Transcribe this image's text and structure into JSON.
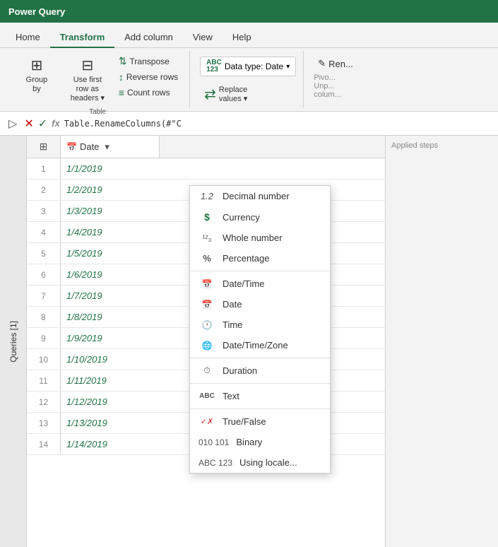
{
  "titleBar": {
    "label": "Power Query"
  },
  "ribbonTabs": [
    {
      "id": "home",
      "label": "Home",
      "active": false
    },
    {
      "id": "transform",
      "label": "Transform",
      "active": true
    },
    {
      "id": "addcolumn",
      "label": "Add column",
      "active": false
    },
    {
      "id": "view",
      "label": "View",
      "active": false
    },
    {
      "id": "help",
      "label": "Help",
      "active": false
    }
  ],
  "ribbon": {
    "groups": [
      {
        "id": "table",
        "label": "Table",
        "buttons": [
          {
            "id": "group-by",
            "label": "Group\nby",
            "type": "large",
            "icon": "⊞"
          },
          {
            "id": "use-first-row",
            "label": "Use first row as\nheaders",
            "type": "large",
            "icon": "⊟"
          }
        ],
        "smallButtons": [
          {
            "id": "transpose",
            "label": "Transpose",
            "icon": "⇅"
          },
          {
            "id": "reverse-rows",
            "label": "Reverse rows",
            "icon": "↕"
          },
          {
            "id": "count-rows",
            "label": "Count rows",
            "icon": "≡"
          }
        ]
      }
    ],
    "datatypeButton": {
      "label": "Data type: Date",
      "icon": "ABC\n123"
    },
    "replaceValues": {
      "label": "Replace\nvalues",
      "icon": "⇄"
    },
    "renameButton": {
      "label": "Ren...",
      "icon": "✎"
    }
  },
  "formulaBar": {
    "formula": "Table.RenameColumns(#\"C"
  },
  "sidebar": {
    "label": "Queries [1]"
  },
  "grid": {
    "column": {
      "icon": "📅",
      "label": "Date"
    },
    "rows": [
      {
        "num": 1,
        "value": "1/1/2019"
      },
      {
        "num": 2,
        "value": "1/2/2019"
      },
      {
        "num": 3,
        "value": "1/3/2019"
      },
      {
        "num": 4,
        "value": "1/4/2019"
      },
      {
        "num": 5,
        "value": "1/5/2019"
      },
      {
        "num": 6,
        "value": "1/6/2019"
      },
      {
        "num": 7,
        "value": "1/7/2019"
      },
      {
        "num": 8,
        "value": "1/8/2019"
      },
      {
        "num": 9,
        "value": "1/9/2019"
      },
      {
        "num": 10,
        "value": "1/10/2019"
      },
      {
        "num": 11,
        "value": "1/11/2019"
      },
      {
        "num": 12,
        "value": "1/12/2019"
      },
      {
        "num": 13,
        "value": "1/13/2019"
      },
      {
        "num": 14,
        "value": "1/14/2019"
      }
    ]
  },
  "datatypeDropdown": {
    "items": [
      {
        "id": "decimal",
        "icon": "1.2",
        "label": "Decimal number",
        "divider": false
      },
      {
        "id": "currency",
        "icon": "$",
        "label": "Currency",
        "divider": false
      },
      {
        "id": "whole",
        "icon": "¹²₃",
        "label": "Whole number",
        "divider": false
      },
      {
        "id": "percentage",
        "icon": "%",
        "label": "Percentage",
        "divider": false
      },
      {
        "id": "datetime",
        "icon": "📅",
        "label": "Date/Time",
        "divider": true
      },
      {
        "id": "date",
        "icon": "📅",
        "label": "Date",
        "divider": false
      },
      {
        "id": "time",
        "icon": "🕐",
        "label": "Time",
        "divider": false
      },
      {
        "id": "datetimezone",
        "icon": "🌐",
        "label": "Date/Time/Zone",
        "divider": false
      },
      {
        "id": "duration",
        "icon": "⏱",
        "label": "Duration",
        "divider": true
      },
      {
        "id": "text",
        "icon": "ABC",
        "label": "Text",
        "divider": true
      },
      {
        "id": "truefalse",
        "icon": "✓✗",
        "label": "True/False",
        "divider": true
      },
      {
        "id": "binary",
        "icon": "010\n101",
        "label": "Binary",
        "divider": false
      },
      {
        "id": "locale",
        "icon": "ABC\n123",
        "label": "Using locale...",
        "divider": false
      }
    ]
  },
  "rightPanel": {
    "unpivotLabel": "Unp...",
    "columnLabel": "colum..."
  }
}
